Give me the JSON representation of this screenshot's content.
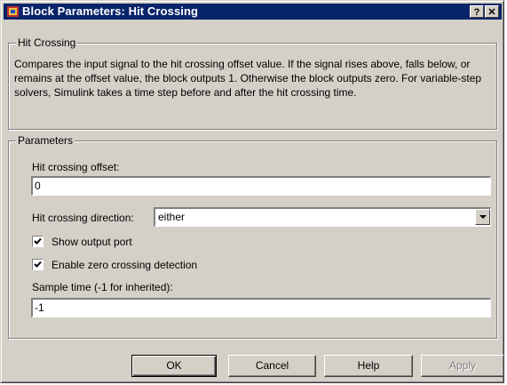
{
  "window": {
    "title": "Block Parameters: Hit  Crossing",
    "help_glyph": "?",
    "close_glyph": "✕"
  },
  "description_group": {
    "legend": "Hit Crossing",
    "text": "Compares the input signal to the hit crossing offset value. If the signal rises above, falls below, or remains at the offset value, the block outputs 1. Otherwise the block outputs zero. For variable-step solvers, Simulink takes a time step before and after the hit crossing time."
  },
  "parameters_group": {
    "legend": "Parameters",
    "offset_label": "Hit crossing offset:",
    "offset_value": "0",
    "direction_label": "Hit crossing direction:",
    "direction_value": "either",
    "show_output_port_label": "Show output port",
    "show_output_port_checked": true,
    "zero_crossing_label": "Enable zero crossing detection",
    "zero_crossing_checked": true,
    "sample_time_label": "Sample time (-1 for inherited):",
    "sample_time_value": "-1"
  },
  "buttons": {
    "ok": "OK",
    "cancel": "Cancel",
    "help": "Help",
    "apply": "Apply",
    "apply_enabled": false
  },
  "colors": {
    "title_bar": "#0a246a",
    "face": "#d4d0c8"
  },
  "icons": {
    "app": "simulink-block-icon",
    "dropdown": "chevron-down-icon",
    "check": "checkmark-icon"
  }
}
